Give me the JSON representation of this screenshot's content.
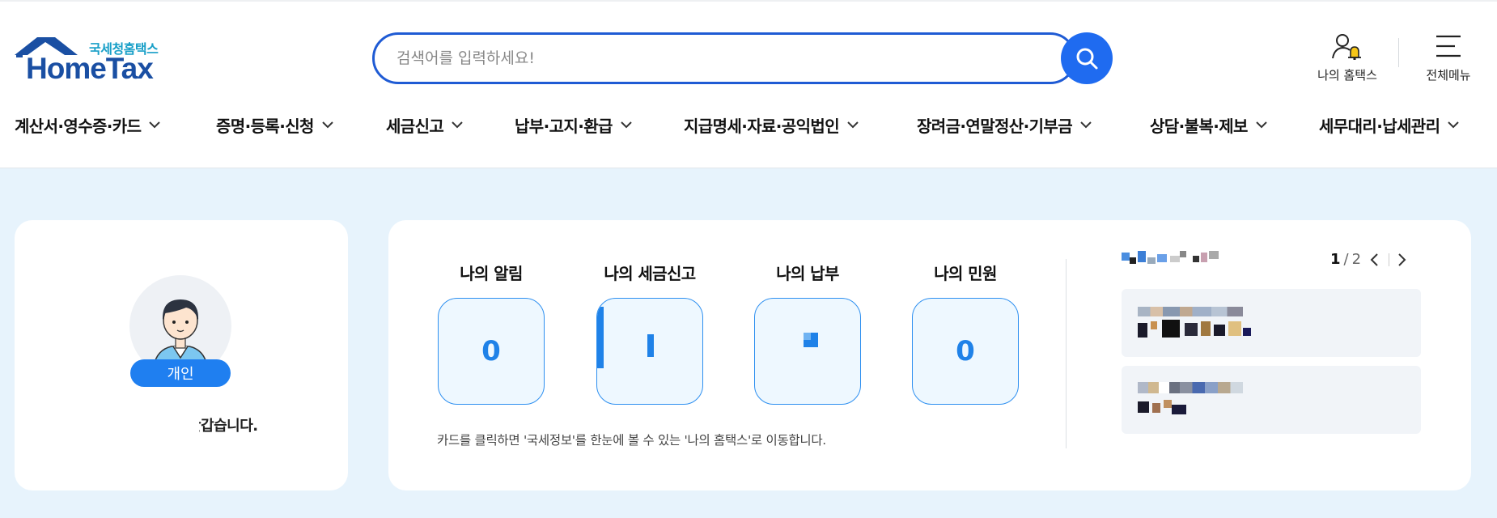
{
  "logo": {
    "sub": "국세청홈택스",
    "main": "HomeTax"
  },
  "search": {
    "placeholder": "검색어를 입력하세요!"
  },
  "top_links": {
    "my_hometax": "나의 홈택스",
    "all_menu": "전체메뉴"
  },
  "nav": [
    "계산서·영수증·카드",
    "증명·등록·신청",
    "세금신고",
    "납부·고지·환급",
    "지급명세·자료·공익법인",
    "장려금·연말정산·기부금",
    "상담·불복·제보",
    "세무대리·납세관리"
  ],
  "profile": {
    "badge": "개인",
    "greeting": "반갑습니다."
  },
  "stats": [
    {
      "title": "나의 알림",
      "value": "0"
    },
    {
      "title": "나의 세금신고",
      "value": ""
    },
    {
      "title": "나의 납부",
      "value": ""
    },
    {
      "title": "나의 민원",
      "value": "0"
    }
  ],
  "hint": "카드를 클릭하면 '국세정보'를 한눈에 볼 수 있는 '나의 홈택스'로 이동합니다.",
  "pager": {
    "current": "1",
    "separator": "/",
    "total": "2"
  },
  "colors": {
    "brand": "#1f6bf0",
    "nav_text": "#111111",
    "background": "#e7f3fc",
    "stat_value": "#1f82e8"
  }
}
